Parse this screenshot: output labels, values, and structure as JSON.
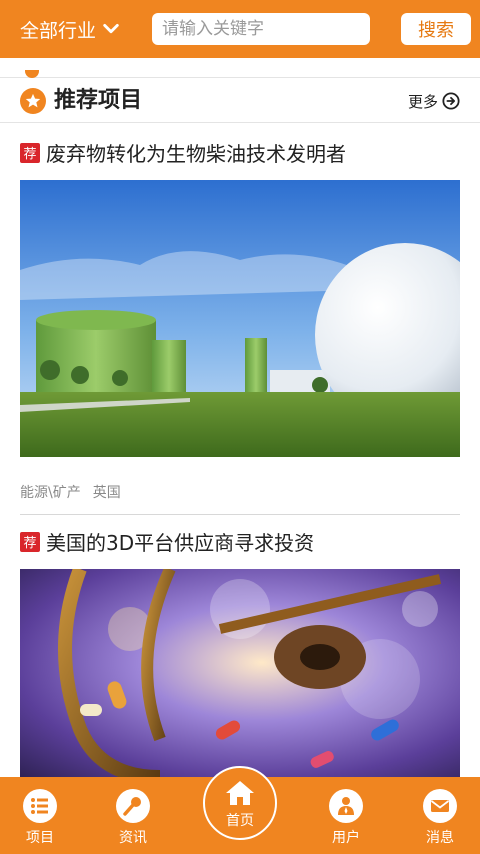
{
  "header": {
    "industry_label": "全部行业",
    "search_placeholder": "请输入关键字",
    "search_button": "搜索"
  },
  "section": {
    "title": "推荐项目",
    "more_label": "更多"
  },
  "cards": [
    {
      "tag": "荐",
      "title": "废弃物转化为生物柴油技术发明者",
      "category": "能源\\矿产",
      "country": "英国"
    },
    {
      "tag": "荐",
      "title": "美国的3D平台供应商寻求投资"
    }
  ],
  "nav": {
    "projects": "项目",
    "news": "资讯",
    "home": "首页",
    "user": "用户",
    "messages": "消息"
  },
  "colors": {
    "brand_orange": "#f08520",
    "tag_red": "#d9262b"
  }
}
